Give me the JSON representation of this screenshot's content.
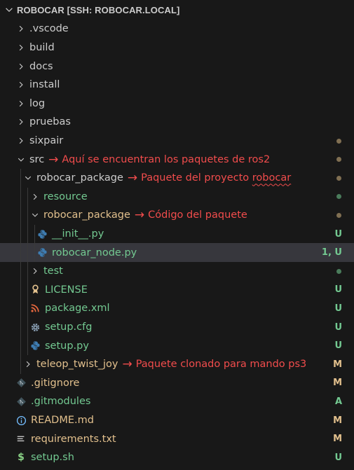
{
  "explorer": {
    "root_title": "ROBOCAR [SSH: ROBOCAR.LOCAL]"
  },
  "colors": {
    "background": "#181818",
    "selected_row": "#37373d",
    "untracked": "#73c991",
    "modified": "#e2c08d",
    "annotation": "#f14c4c",
    "ignored": "#8c8c8c"
  },
  "tree": [
    {
      "id": "vscode",
      "label": ".vscode",
      "kind": "folder",
      "expanded": false,
      "depth": 0,
      "status": "none"
    },
    {
      "id": "build",
      "label": "build",
      "kind": "folder",
      "expanded": false,
      "depth": 0,
      "status": "none"
    },
    {
      "id": "docs",
      "label": "docs",
      "kind": "folder",
      "expanded": false,
      "depth": 0,
      "status": "none"
    },
    {
      "id": "install",
      "label": "install",
      "kind": "folder",
      "expanded": false,
      "depth": 0,
      "status": "none"
    },
    {
      "id": "log",
      "label": "log",
      "kind": "folder",
      "expanded": false,
      "depth": 0,
      "status": "none"
    },
    {
      "id": "pruebas",
      "label": "pruebas",
      "kind": "folder",
      "expanded": false,
      "depth": 0,
      "status": "none"
    },
    {
      "id": "sixpair",
      "label": "sixpair",
      "kind": "folder",
      "expanded": false,
      "depth": 0,
      "status": "dot-modified"
    },
    {
      "id": "src",
      "label": "src",
      "kind": "folder",
      "expanded": true,
      "depth": 0,
      "status": "dot-modified",
      "annotation": "Aquí se encuentran los paquetes de ros2"
    },
    {
      "id": "robocar-package",
      "label": "robocar_package",
      "kind": "folder",
      "expanded": true,
      "depth": 1,
      "status": "dot-modified",
      "annotation": "Paquete del proyecto ",
      "annotation_squiggle": "robocar"
    },
    {
      "id": "resource",
      "label": "resource",
      "kind": "folder",
      "expanded": false,
      "depth": 2,
      "status": "dot-untracked",
      "labelColor": "green"
    },
    {
      "id": "robocar-package-inner",
      "label": "robocar_package",
      "kind": "folder",
      "expanded": true,
      "depth": 2,
      "status": "dot-modified",
      "labelColor": "mod",
      "annotation": "Código del paquete"
    },
    {
      "id": "init-py",
      "label": "__init__.py",
      "kind": "python",
      "depth": 3,
      "badge": "U",
      "labelColor": "green"
    },
    {
      "id": "robocar-node-py",
      "label": "robocar_node.py",
      "kind": "python",
      "depth": 3,
      "badge": "1, U",
      "labelColor": "green",
      "selected": true
    },
    {
      "id": "test",
      "label": "test",
      "kind": "folder",
      "expanded": false,
      "depth": 2,
      "status": "dot-untracked",
      "labelColor": "green"
    },
    {
      "id": "license",
      "label": "LICENSE",
      "kind": "license",
      "depth": 2,
      "badge": "U",
      "labelColor": "green"
    },
    {
      "id": "package-xml",
      "label": "package.xml",
      "kind": "rss",
      "depth": 2,
      "badge": "U",
      "labelColor": "green"
    },
    {
      "id": "setup-cfg",
      "label": "setup.cfg",
      "kind": "gear",
      "depth": 2,
      "badge": "U",
      "labelColor": "green"
    },
    {
      "id": "setup-py",
      "label": "setup.py",
      "kind": "python",
      "depth": 2,
      "badge": "U",
      "labelColor": "green"
    },
    {
      "id": "teleop-twist-joy",
      "label": "teleop_twist_joy",
      "kind": "folder",
      "expanded": false,
      "depth": 1,
      "badge": "M",
      "labelColor": "mod",
      "annotation": "Paquete clonado para mando ps3"
    },
    {
      "id": "gitignore",
      "label": ".gitignore",
      "kind": "git",
      "depth": 0,
      "badge": "M",
      "labelColor": "mod"
    },
    {
      "id": "gitmodules",
      "label": ".gitmodules",
      "kind": "git",
      "depth": 0,
      "badge": "A",
      "labelColor": "green"
    },
    {
      "id": "readme-md",
      "label": "README.md",
      "kind": "info",
      "depth": 0,
      "badge": "M",
      "labelColor": "mod"
    },
    {
      "id": "requirements-txt",
      "label": "requirements.txt",
      "kind": "lines",
      "depth": 0,
      "badge": "M",
      "labelColor": "mod"
    },
    {
      "id": "setup-sh",
      "label": "setup.sh",
      "kind": "dollar",
      "depth": 0,
      "badge": "U",
      "labelColor": "green"
    }
  ]
}
